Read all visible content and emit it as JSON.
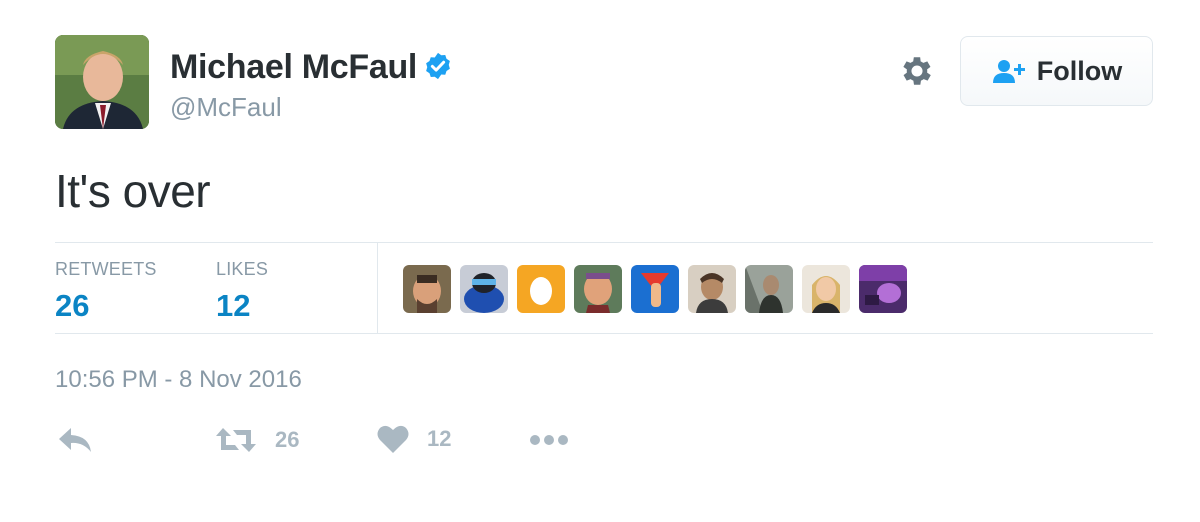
{
  "user": {
    "name": "Michael McFaul",
    "handle": "@McFaul",
    "verified": true
  },
  "header": {
    "follow_label": "Follow"
  },
  "tweet": {
    "text": "It's over",
    "timestamp": "10:56 PM - 8 Nov 2016"
  },
  "stats": {
    "retweets_label": "RETWEETS",
    "retweets_count": "26",
    "likes_label": "LIKES",
    "likes_count": "12"
  },
  "liker_avatars": [
    "avatar-1",
    "avatar-2",
    "avatar-3",
    "avatar-4",
    "avatar-5",
    "avatar-6",
    "avatar-7",
    "avatar-8",
    "avatar-9"
  ],
  "actions": {
    "retweet_count": "26",
    "like_count": "12"
  },
  "colors": {
    "accent": "#0b84c4",
    "verified": "#1da1f2",
    "muted": "#8899a6",
    "icon": "#aab8c2"
  }
}
